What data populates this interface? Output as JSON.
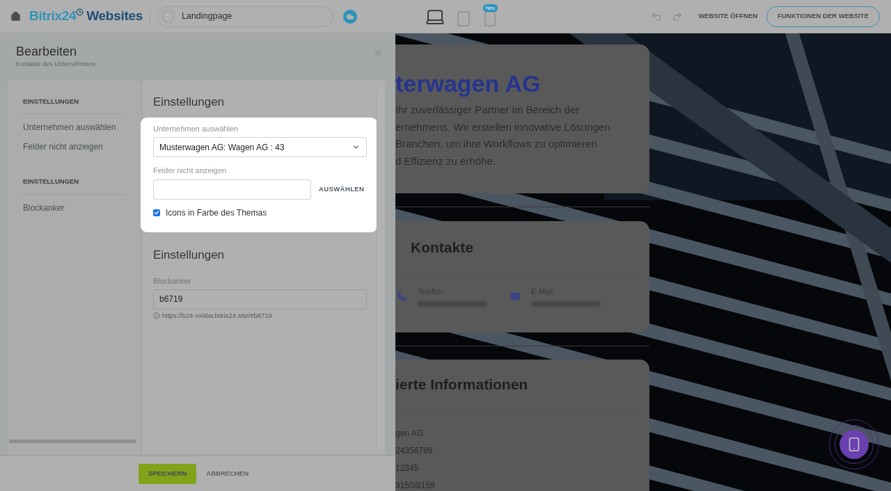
{
  "topbar": {
    "brand": {
      "part1": "Bitrix24",
      "part2": "Websites"
    },
    "page_field": {
      "value": "Landingpage"
    },
    "devices": [
      {
        "kind": "desktop",
        "selected": true
      },
      {
        "kind": "tablet",
        "selected": false
      },
      {
        "kind": "mobile",
        "selected": false,
        "badge": "Neu"
      }
    ],
    "open_link": "WEBSITE ÖFFNEN",
    "features_button": "FUNKTIONEN DER WEBSITE"
  },
  "editor": {
    "title": "Bearbeiten",
    "subtitle": "Kontakte des Unternehmens",
    "nav": [
      {
        "heading": "EINSTELLUNGEN",
        "items": [
          "Unternehmen auswählen",
          "Felder nicht anzeigen"
        ]
      },
      {
        "heading": "EINSTELLUNGEN",
        "items": [
          "Blockanker"
        ]
      }
    ],
    "sections": [
      {
        "title": "Einstellungen",
        "highlighted": true,
        "fields": [
          {
            "kind": "select",
            "label": "Unternehmen auswählen",
            "value": "Musterwagen AG: Wagen AG : 43"
          },
          {
            "kind": "picker",
            "label": "Felder nicht anzeigen",
            "button": "AUSWÄHLEN"
          },
          {
            "kind": "checkbox",
            "label": "Icons in Farbe des Themas",
            "checked": true
          }
        ]
      },
      {
        "title": "Einstellungen",
        "highlighted": false,
        "fields": [
          {
            "kind": "text",
            "label": "Blockanker",
            "value": "b6719",
            "hint": "https://b24-sxii6w.bitrix24.site/#b6719"
          }
        ]
      }
    ],
    "footer": {
      "save": "SPEICHERN",
      "cancel": "ABBRECHEN"
    }
  },
  "preview": {
    "hero": {
      "title": "terwagen AG",
      "lines": [
        "Ihr zuverlässiger Partner im Bereich der",
        "ernehmens. Wir erstellen innovative Lösungen",
        "Branchen, um ihre Workflows zu optimieren",
        "d Effizienz zu erhöhe."
      ]
    },
    "contacts": {
      "title": "Kontakte",
      "items": [
        {
          "kind": "phone",
          "label": "Telefon:"
        },
        {
          "kind": "email",
          "label": "E-Mail:"
        }
      ]
    },
    "details": {
      "title": "ierte Informationen",
      "lines": [
        "gen AG",
        "24356789",
        "12345",
        "3150/8159"
      ]
    }
  }
}
